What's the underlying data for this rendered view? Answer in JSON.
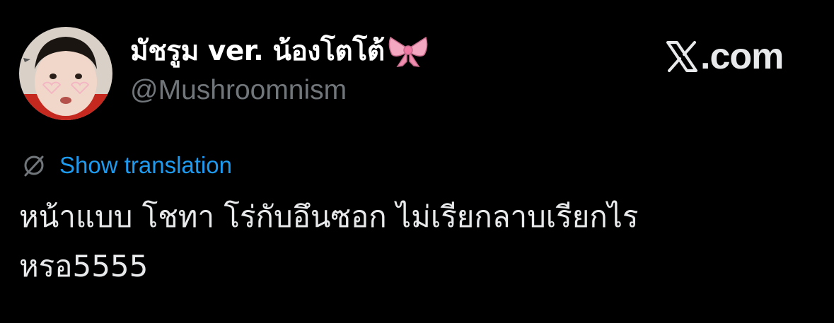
{
  "author": {
    "display_name": "มัชรูม ver. น้องโตโต้",
    "handle": "@Mushroomnism",
    "name_emoji": "ribbon-bow-emoji"
  },
  "brand": {
    "icon": "x-logo-icon",
    "text": ".com"
  },
  "translation": {
    "icon": "translate-globe-icon",
    "label": "Show translation"
  },
  "tweet": {
    "lines": [
      "หน้าแบบ โชทา โร่กับอึนซอก ไม่เรียกลาบเรียกไร",
      "หรอ5555"
    ]
  },
  "colors": {
    "background": "#000000",
    "text": "#e7e9ea",
    "secondary": "#71767b",
    "link": "#1d9bf0",
    "bow": "#f4a7c0"
  }
}
